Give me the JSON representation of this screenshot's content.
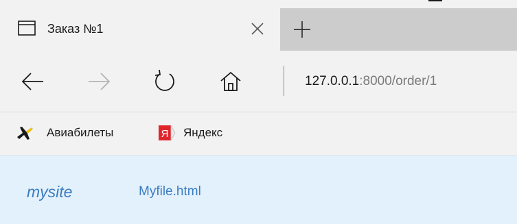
{
  "tab": {
    "title": "Заказ №1",
    "icon": "tab-page-icon"
  },
  "toolbar": {
    "back_icon": "arrow-left-icon",
    "forward_icon": "arrow-right-icon",
    "refresh_icon": "refresh-icon",
    "home_icon": "home-icon",
    "close_icon": "close-icon",
    "new_tab_icon": "plus-icon"
  },
  "address": {
    "host": "127.0.0.1",
    "rest": ":8000/order/1"
  },
  "favorites": [
    {
      "label": "Авиабилеты",
      "icon": "airplane-icon"
    },
    {
      "label": "Яндекс",
      "icon": "yandex-icon"
    }
  ],
  "page": {
    "brand": "mysite",
    "link": "Myfile.html"
  },
  "colors": {
    "chrome_bg": "#f2f2f2",
    "inactive_tab_bg": "#cccccc",
    "page_bg": "#e3f1fd",
    "link": "#3a7cbf",
    "yandex_red": "#e0262b",
    "airplane_yellow": "#f5c400"
  }
}
